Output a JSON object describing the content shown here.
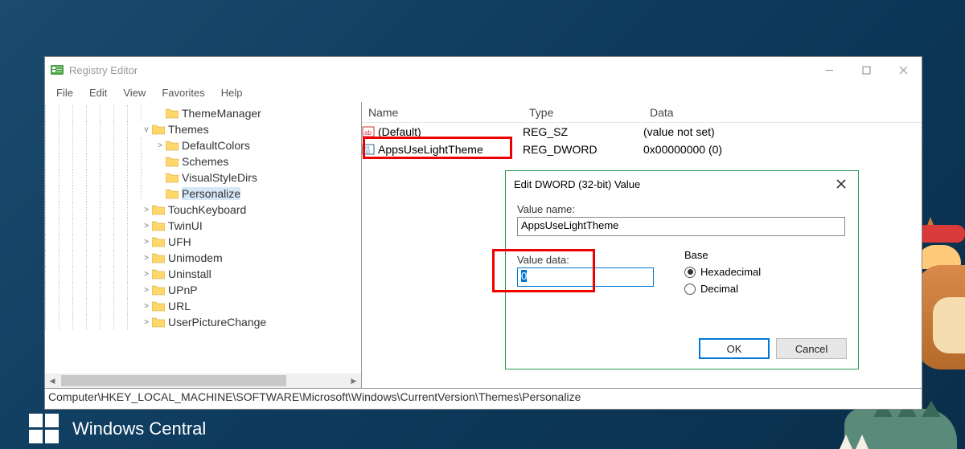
{
  "window": {
    "title": "Registry Editor"
  },
  "menu": {
    "file": "File",
    "edit": "Edit",
    "view": "View",
    "favorites": "Favorites",
    "help": "Help"
  },
  "tree": [
    {
      "depth": 8,
      "expander": "",
      "label": "ThemeManager"
    },
    {
      "depth": 7,
      "expander": "v",
      "label": "Themes"
    },
    {
      "depth": 8,
      "expander": ">",
      "label": "DefaultColors"
    },
    {
      "depth": 8,
      "expander": "",
      "label": "Schemes"
    },
    {
      "depth": 8,
      "expander": "",
      "label": "VisualStyleDirs"
    },
    {
      "depth": 8,
      "expander": "",
      "label": "Personalize",
      "selected": true
    },
    {
      "depth": 7,
      "expander": ">",
      "label": "TouchKeyboard"
    },
    {
      "depth": 7,
      "expander": ">",
      "label": "TwinUI"
    },
    {
      "depth": 7,
      "expander": ">",
      "label": "UFH"
    },
    {
      "depth": 7,
      "expander": ">",
      "label": "Unimodem"
    },
    {
      "depth": 7,
      "expander": ">",
      "label": "Uninstall"
    },
    {
      "depth": 7,
      "expander": ">",
      "label": "UPnP"
    },
    {
      "depth": 7,
      "expander": ">",
      "label": "URL"
    },
    {
      "depth": 7,
      "expander": ">",
      "label": "UserPictureChange"
    }
  ],
  "list": {
    "headers": {
      "name": "Name",
      "type": "Type",
      "data": "Data"
    },
    "rows": [
      {
        "icon": "sz",
        "name": "(Default)",
        "type": "REG_SZ",
        "data": "(value not set)"
      },
      {
        "icon": "dword",
        "name": "AppsUseLightTheme",
        "type": "REG_DWORD",
        "data": "0x00000000 (0)"
      }
    ]
  },
  "dialog": {
    "title": "Edit DWORD (32-bit) Value",
    "value_name_label": "Value name:",
    "value_name": "AppsUseLightTheme",
    "value_data_label": "Value data:",
    "value_data": "0",
    "base_label": "Base",
    "hex_label": "Hexadecimal",
    "dec_label": "Decimal",
    "ok": "OK",
    "cancel": "Cancel"
  },
  "statusbar": "Computer\\HKEY_LOCAL_MACHINE\\SOFTWARE\\Microsoft\\Windows\\CurrentVersion\\Themes\\Personalize",
  "brand": "Windows Central"
}
